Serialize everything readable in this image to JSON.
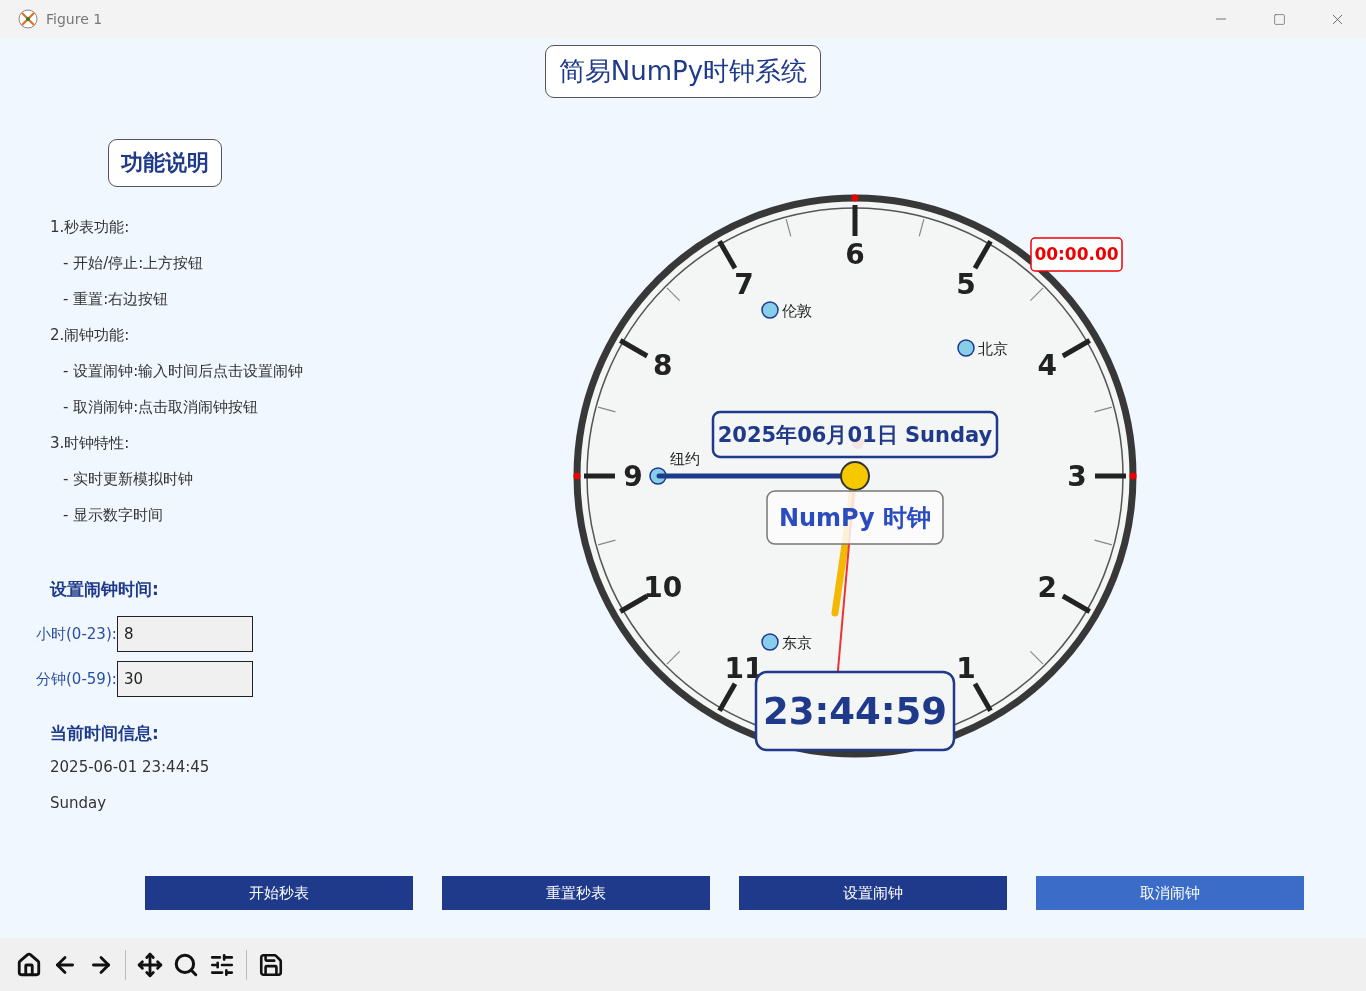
{
  "window": {
    "title": "Figure 1"
  },
  "title": "简易NumPy时钟系统",
  "instructions": {
    "heading": "功能说明",
    "lines": [
      {
        "text": "1.秒表功能:",
        "kind": "section"
      },
      {
        "text": "- 开始/停止:上方按钮",
        "kind": "item"
      },
      {
        "text": "- 重置:右边按钮",
        "kind": "item"
      },
      {
        "text": "2.闹钟功能:",
        "kind": "section"
      },
      {
        "text": "- 设置闹钟:输入时间后点击设置闹钟",
        "kind": "item"
      },
      {
        "text": "- 取消闹钟:点击取消闹钟按钮",
        "kind": "item"
      },
      {
        "text": "3.时钟特性:",
        "kind": "section"
      },
      {
        "text": "- 实时更新模拟时钟",
        "kind": "item"
      },
      {
        "text": "- 显示数字时间",
        "kind": "item"
      }
    ]
  },
  "alarm": {
    "heading": "设置闹钟时间:",
    "fields": [
      {
        "label": "小时(0-23):",
        "value": "8"
      },
      {
        "label": "分钟(0-59):",
        "value": "30"
      }
    ]
  },
  "info": {
    "heading": "当前时间信息:",
    "lines": [
      "2025-06-01 23:44:45",
      "Sunday"
    ]
  },
  "clock": {
    "numbers": [
      "6",
      "5",
      "4",
      "3",
      "2",
      "1",
      "11",
      "10",
      "9",
      "8",
      "7"
    ],
    "cities": [
      "伦敦",
      "北京",
      "纽约",
      "东京"
    ],
    "date": "2025年06月01日 Sunday",
    "label": "NumPy 时钟",
    "digital": "23:44:59",
    "stopwatch": "00:00.00"
  },
  "buttons": [
    {
      "label": "开始秒表",
      "hovered": false
    },
    {
      "label": "重置秒表",
      "hovered": false
    },
    {
      "label": "设置闹钟",
      "hovered": false
    },
    {
      "label": "取消闹钟",
      "hovered": true
    }
  ]
}
